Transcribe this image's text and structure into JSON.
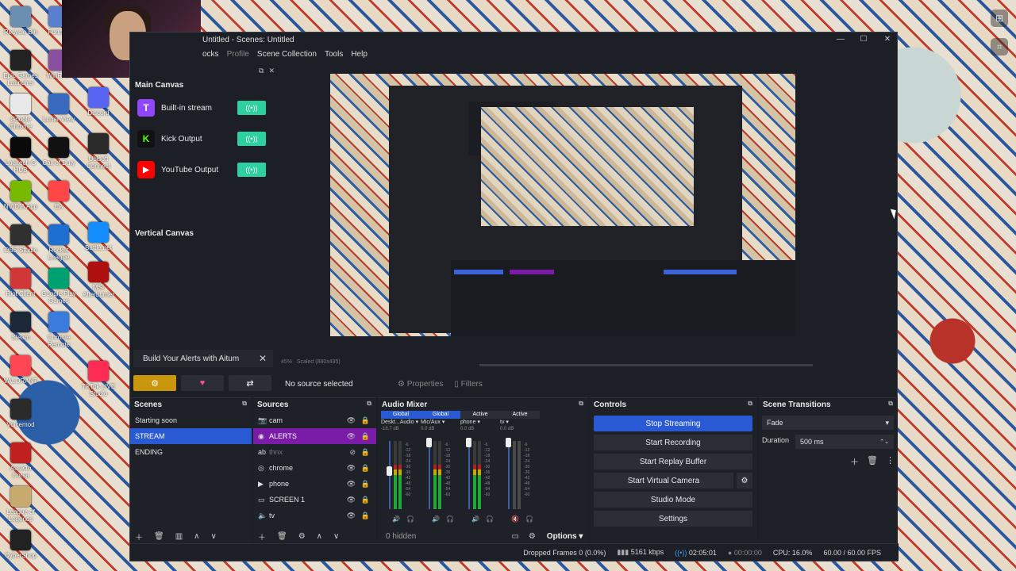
{
  "desktop": {
    "icons": [
      {
        "label": "Recycle Bin",
        "color": "#6b8fb0"
      },
      {
        "label": "Epic Games Launcher",
        "color": "#222222"
      },
      {
        "label": "Google Chrome",
        "color": "#e8e8e8"
      },
      {
        "label": "Logitech G HUB",
        "color": "#0a0a0a"
      },
      {
        "label": "NVIDIA App",
        "color": "#76b900"
      },
      {
        "label": "OBS Studio",
        "color": "#303030"
      },
      {
        "label": "Riot Client",
        "color": "#d13639"
      },
      {
        "label": "Steam",
        "color": "#1b2838"
      },
      {
        "label": "VALORANT",
        "color": "#ff4655"
      },
      {
        "label": "Voicemod",
        "color": "#2a2a2a"
      },
      {
        "label": "Assetto Corsa",
        "color": "#c02020"
      },
      {
        "label": "League of Legends",
        "color": "#c8aa6e"
      },
      {
        "label": "CyberShop",
        "color": "#222222"
      },
      {
        "label": "Fortnite",
        "color": "#5b7fd0"
      },
      {
        "label": "WinRAR",
        "color": "#8a4f9e"
      },
      {
        "label": "Lunar View",
        "color": "#3a6ac0"
      },
      {
        "label": "Call of Duty",
        "color": "#111111"
      },
      {
        "label": "EA",
        "color": "#ff4747"
      },
      {
        "label": "Rocket League",
        "color": "#1d6fd1"
      },
      {
        "label": "Google Play Games",
        "color": "#00a170"
      },
      {
        "label": "Chrome Remote",
        "color": "#3a7be0"
      },
      {
        "label": "Discord",
        "color": "#5865f2"
      },
      {
        "label": "Ubisoft Connect",
        "color": "#2a2a2a"
      },
      {
        "label": "Battle.net",
        "color": "#148eff"
      },
      {
        "label": "MSI Afterburner",
        "color": "#b01010"
      },
      {
        "label": "TikTok LIVE Studio",
        "color": "#fe2c55"
      }
    ]
  },
  "window": {
    "title": "Untitled - Scenes: Untitled",
    "menu": [
      "ocks",
      "Profile",
      "Scene Collection",
      "Tools",
      "Help"
    ]
  },
  "dock": {
    "main_canvas_label": "Main Canvas",
    "outputs": [
      {
        "name": "Built-in stream",
        "logo": "T",
        "color": "#9146ff"
      },
      {
        "name": "Kick Output",
        "logo": "K",
        "color": "#111111"
      },
      {
        "name": "YouTube Output",
        "logo": "▶",
        "color": "#ff0000"
      }
    ],
    "vertical_canvas_label": "Vertical Canvas",
    "alerts_banner": "Build Your Alerts with Aitum"
  },
  "preview_bar": {
    "zoom": "45%",
    "scaled": "Scaled (880x495)"
  },
  "source_bar": {
    "no_source": "No source selected",
    "properties": "Properties",
    "filters": "Filters"
  },
  "scenes": {
    "title": "Scenes",
    "items": [
      "Starting soon",
      "STREAM",
      "ENDING"
    ],
    "selected": "STREAM"
  },
  "sources": {
    "title": "Sources",
    "items": [
      {
        "name": "cam",
        "icon": "📷",
        "hidden": false
      },
      {
        "name": "ALERTS",
        "icon": "◉",
        "hidden": false
      },
      {
        "name": "thnx",
        "icon": "ab",
        "hidden": true
      },
      {
        "name": "chrome",
        "icon": "◎",
        "hidden": false
      },
      {
        "name": "phone",
        "icon": "▶",
        "hidden": false
      },
      {
        "name": "SCREEN 1",
        "icon": "▭",
        "hidden": false
      },
      {
        "name": "tv",
        "icon": "🔈",
        "hidden": false
      }
    ]
  },
  "mixer": {
    "title": "Audio Mixer",
    "channels": [
      {
        "head": "Global",
        "name": "Deskt...Audio",
        "db": "-18.7 dB",
        "level": 0.55
      },
      {
        "head": "Global",
        "name": "Mic/Aux",
        "db": "0.0 dB",
        "level": 0.6
      },
      {
        "head": "Active",
        "name": "phone",
        "db": "0.0 dB",
        "level": 0.55
      },
      {
        "head": "Active",
        "name": "tv",
        "db": "0.0 dB",
        "level": 0.0
      }
    ],
    "ticks": [
      "-6",
      "-12",
      "-18",
      "-24",
      "-30",
      "-36",
      "-42",
      "-48",
      "-54",
      "-60"
    ],
    "hidden": "0 hidden",
    "options": "Options"
  },
  "controls": {
    "title": "Controls",
    "buttons": [
      "Stop Streaming",
      "Start Recording",
      "Start Replay Buffer",
      "Start Virtual Camera",
      "Studio Mode",
      "Settings"
    ]
  },
  "transitions": {
    "title": "Scene Transitions",
    "type": "Fade",
    "duration_label": "Duration",
    "duration": "500 ms"
  },
  "status": {
    "dropped": "Dropped Frames 0 (0.0%)",
    "bitrate": "5161 kbps",
    "stream_time": "02:05:01",
    "rec_time": "00:00:00",
    "cpu": "CPU: 16.0%",
    "fps": "60.00 / 60.00 FPS"
  }
}
